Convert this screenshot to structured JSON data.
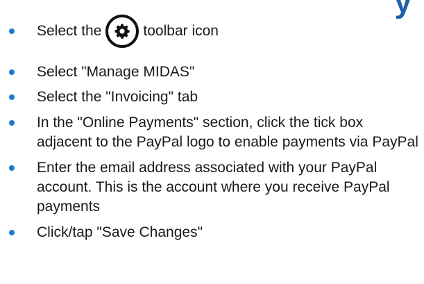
{
  "heading": {
    "fragment": "y"
  },
  "steps": [
    {
      "before_icon": "Select the",
      "icon": "gear-icon",
      "after_icon": "toolbar icon"
    },
    {
      "text": "Select \"Manage MIDAS\""
    },
    {
      "text": "Select the \"Invoicing\" tab"
    },
    {
      "text": "In the \"Online Payments\" section, click the tick box adjacent to the PayPal logo to enable payments via PayPal"
    },
    {
      "text": "Enter the email address associated with your PayPal account. This is the account where you receive PayPal payments"
    },
    {
      "text": "Click/tap \"Save Changes\""
    }
  ],
  "colors": {
    "bullet": "#1c7bd1",
    "heading": "#1f5fa8",
    "text": "#1a1a1a"
  }
}
